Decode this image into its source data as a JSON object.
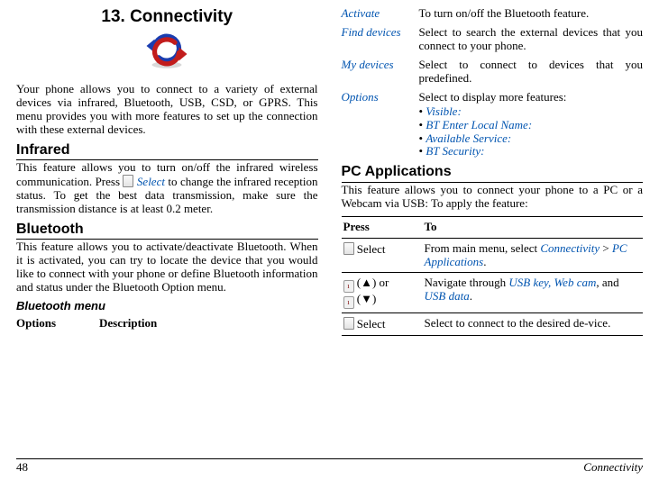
{
  "chapter": {
    "title": "13. Connectivity"
  },
  "intro": "Your phone allows you to connect to a variety of external devices via infrared, Bluetooth, USB, CSD, or GPRS. This menu provides you with more features to set up the connection with these external devices.",
  "infrared": {
    "heading": "Infrared",
    "text_a": "This feature allows you to turn on/off the infrared wireless communication. Press ",
    "select": "Select",
    "text_b": " to change the infrared reception status. To get the best data transmission, make sure the transmission distance is at least 0.2 meter."
  },
  "bluetooth": {
    "heading": "Bluetooth",
    "text": "This feature allows you to activate/deactivate Bluetooth. When it is activated, you can try to locate the device that you would like to connect with your phone or define Bluetooth information and status under the Bluetooth Option menu.",
    "menu_heading": "Bluetooth menu",
    "table_head": {
      "c1": "Options",
      "c2": "Description"
    }
  },
  "bt_options": {
    "activate": {
      "label": "Activate",
      "desc": "To turn on/off the Bluetooth feature."
    },
    "find": {
      "label": "Find devices",
      "desc": "Select to search the external devices that you connect to your phone."
    },
    "mydev": {
      "label": "My devices",
      "desc": "Select to connect to devices that you predefined."
    },
    "options": {
      "label": "Options",
      "desc": "Select to display more features:",
      "items": {
        "a": "Visible:",
        "b": "BT Enter Local Name:",
        "c": "Available Service:",
        "d": "BT Security:"
      }
    }
  },
  "pcapp": {
    "heading": "PC Applications",
    "intro": "This feature allows you to connect your phone to a PC or a Webcam via USB: To apply the feature:",
    "head": {
      "press": "Press",
      "to": "To"
    },
    "r1": {
      "key": "Select",
      "to_a": "From main menu, select ",
      "link1": "Connectivity",
      "sep": " > ",
      "link2": "PC Applications",
      "dot": "."
    },
    "r2": {
      "up": "(▲)",
      "or": " or ",
      "down": "(▼)",
      "to_a": "Navigate through ",
      "l1": "USB key, Web cam",
      "mid": ", and ",
      "l2": "USB data",
      "dot": "."
    },
    "r3": {
      "key": "Select",
      "to": "Select to connect to the desired de-vice."
    }
  },
  "footer": {
    "page": "48",
    "title": "Connectivity"
  }
}
